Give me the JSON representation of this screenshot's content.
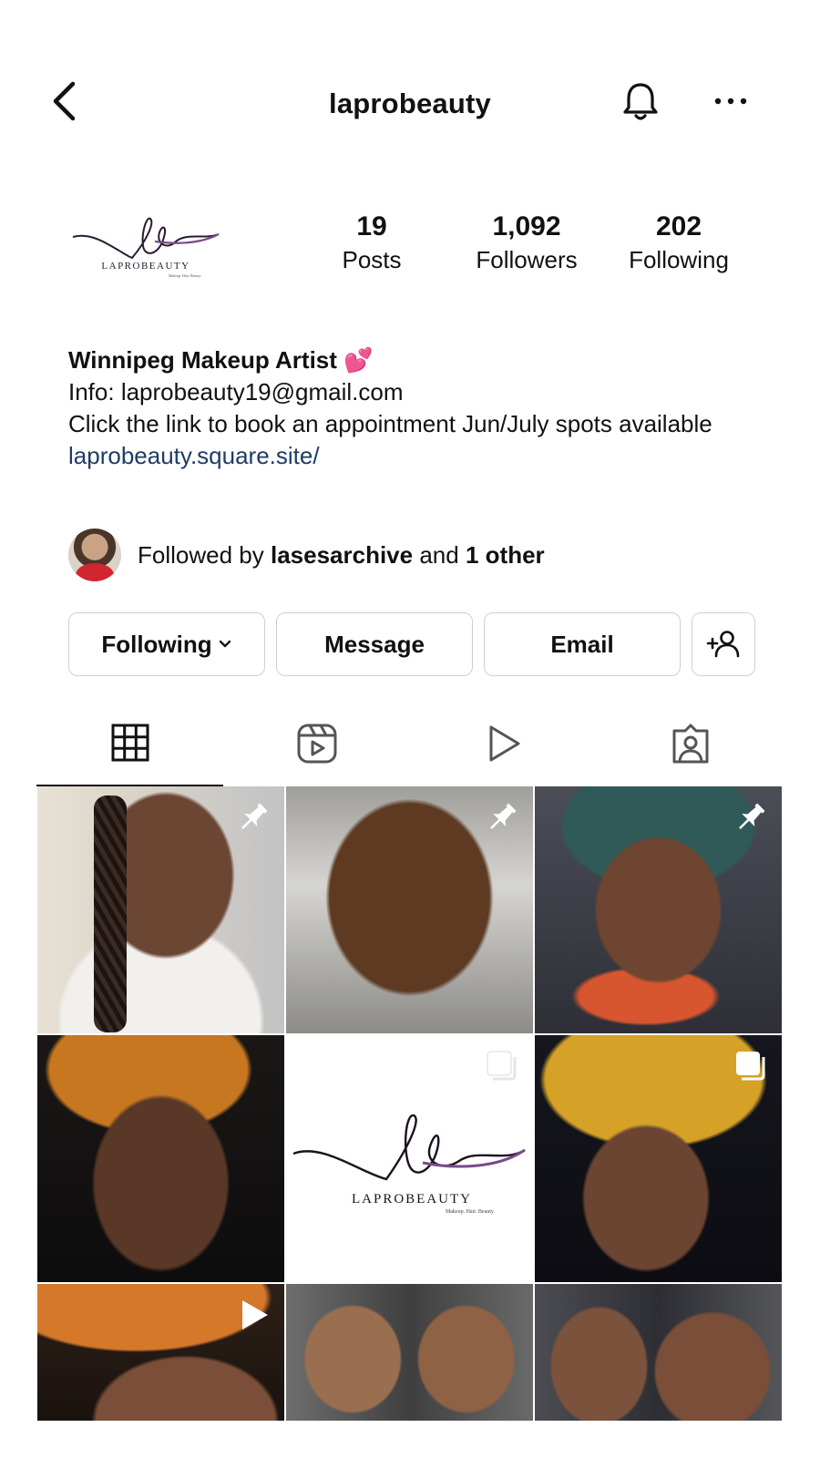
{
  "header": {
    "username": "laprobeauty",
    "back_icon": "chevron-left-icon",
    "bell_icon": "bell-icon",
    "more_icon": "more-horizontal-icon"
  },
  "profile": {
    "logo_text": "LAPROBEAUTY",
    "logo_tagline": "Makeup. Hair. Beauty.",
    "stats": {
      "posts": {
        "value": "19",
        "label": "Posts"
      },
      "followers": {
        "value": "1,092",
        "label": "Followers"
      },
      "following": {
        "value": "202",
        "label": "Following"
      }
    },
    "bio": {
      "name": "Winnipeg Makeup Artist 💕",
      "info": "Info: laprobeauty19@gmail.com",
      "line": "Click the link to book an appointment Jun/July spots available",
      "link": "laprobeauty.square.site/"
    },
    "followed_by": {
      "prefix": "Followed by",
      "user": "lasesarchive",
      "joiner": "and",
      "others": "1 other"
    }
  },
  "actions": {
    "following_label": "Following",
    "message_label": "Message",
    "email_label": "Email",
    "add_user_icon": "add-user-icon"
  },
  "tabs": [
    {
      "name": "grid",
      "icon": "grid-icon",
      "active": true
    },
    {
      "name": "reels",
      "icon": "reels-icon",
      "active": false
    },
    {
      "name": "videos",
      "icon": "play-icon",
      "active": false
    },
    {
      "name": "tagged",
      "icon": "tagged-icon",
      "active": false
    }
  ],
  "posts": [
    {
      "badge": "pin-icon"
    },
    {
      "badge": "pin-icon"
    },
    {
      "badge": "pin-icon"
    },
    {
      "badge": "none"
    },
    {
      "badge": "carousel-icon"
    },
    {
      "badge": "carousel-icon"
    },
    {
      "badge": "reel-play-icon"
    },
    {
      "badge": "none"
    },
    {
      "badge": "none"
    }
  ],
  "post5_logo": {
    "text": "LAPROBEAUTY",
    "tagline": "Makeup. Hair. Beauty."
  },
  "colors": {
    "link": "#1f3c66",
    "border": "#cfcfcf",
    "logo_purple": "#7a4a8a"
  }
}
